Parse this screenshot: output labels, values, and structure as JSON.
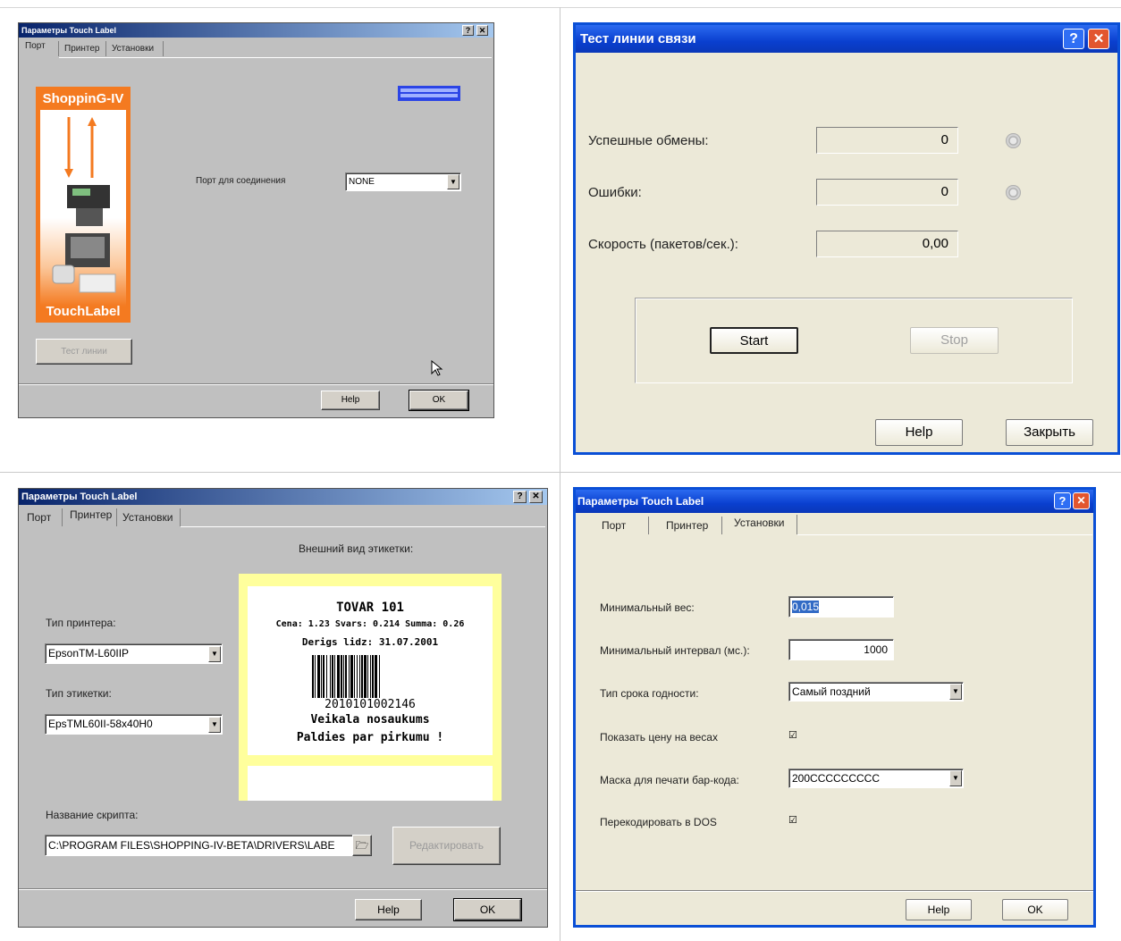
{
  "panel1": {
    "title": "Параметры Touch Label",
    "tabs": [
      "Порт",
      "Принтер",
      "Установки"
    ],
    "logo_top": "ShoppinG-IV",
    "logo_bottom": "TouchLabel",
    "port_label": "Порт для соединения",
    "port_value": "NONE",
    "test_button": "Тест линии",
    "help_button": "Help",
    "ok_button": "OK"
  },
  "panel2": {
    "title": "Тест линии связи",
    "success_label": "Успешные обмены:",
    "success_value": "0",
    "errors_label": "Ошибки:",
    "errors_value": "0",
    "speed_label": "Скорость (пакетов/сек.):",
    "speed_value": "0,00",
    "start_button": "Start",
    "stop_button": "Stop",
    "help_button": "Help",
    "close_button": "Закрыть"
  },
  "panel3": {
    "title": "Параметры Touch Label",
    "tabs": [
      "Порт",
      "Принтер",
      "Установки"
    ],
    "preview_label": "Внешний вид этикетки:",
    "printer_type_label": "Тип принтера:",
    "printer_type_value": "EpsonTM-L60IIP",
    "label_type_label": "Тип этикетки:",
    "label_type_value": "EpsTML60II-58x40H0",
    "label_preview": {
      "line1": "TOVAR 101",
      "line2": "Cena: 1.23 Svars: 0.214 Summa: 0.26",
      "line3": "Derigs lidz: 31.07.2001",
      "barcode": "2010101002146",
      "line4": "Veikala nosaukums",
      "line5": "Paldies par pirkumu !"
    },
    "script_label": "Название скрипта:",
    "script_value": "C:\\PROGRAM FILES\\SHOPPING-IV-BETA\\DRIVERS\\LABE",
    "edit_button": "Редактировать",
    "help_button": "Help",
    "ok_button": "OK"
  },
  "panel4": {
    "title": "Параметры Touch Label",
    "tabs": [
      "Порт",
      "Принтер",
      "Установки"
    ],
    "min_weight_label": "Минимальный вес:",
    "min_weight_value": "0,015",
    "min_interval_label": "Минимальный интервал (мс.):",
    "min_interval_value": "1000",
    "expiry_type_label": "Тип срока годности:",
    "expiry_type_value": "Самый поздний",
    "show_price_label": "Показать цену на весах",
    "barcode_mask_label": "Маска для печати бар-кода:",
    "barcode_mask_value": "200CCCCCCCCC",
    "recode_label": "Перекодировать в DOS",
    "help_button": "Help",
    "ok_button": "OK"
  },
  "colors": {
    "xp_title_blue": "#0a3fcf",
    "classic_title_navy": "#08246b",
    "logo_orange": "#f47a20",
    "label_yellow": "#ffff9c"
  }
}
